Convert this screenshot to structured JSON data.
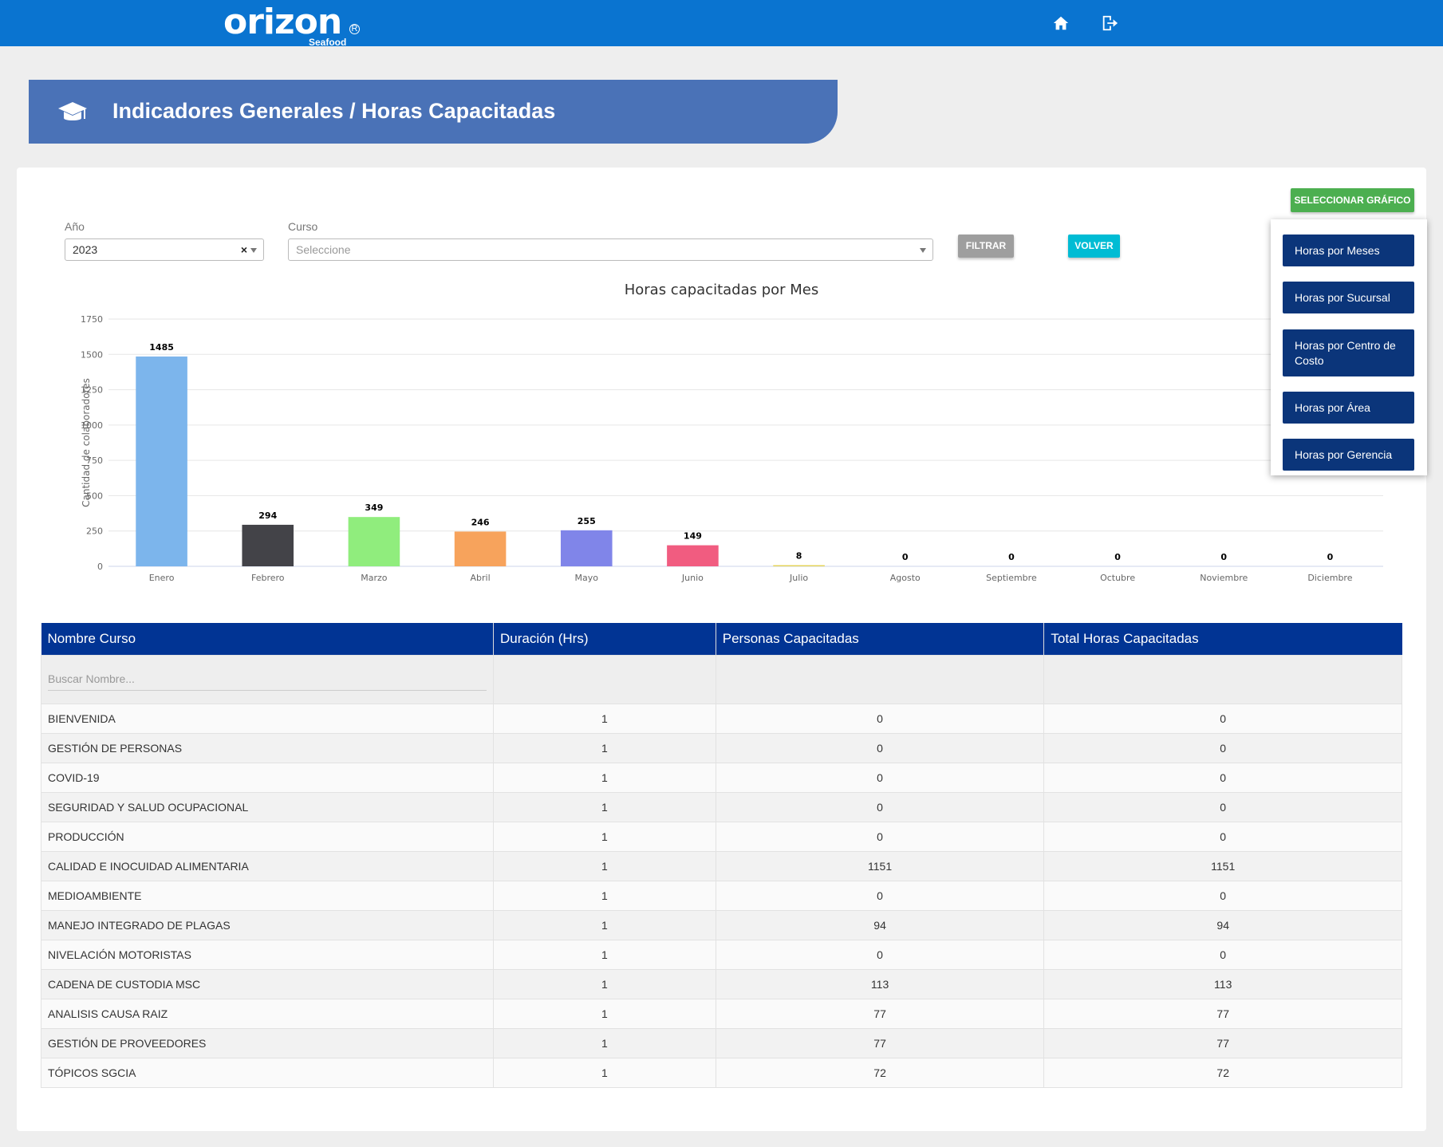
{
  "header": {
    "logo_text": "orizon",
    "logo_sub": "Seafood",
    "logo_reg": "R",
    "bg_color": "#0a74d0",
    "icons": [
      "home-icon",
      "logout-icon"
    ]
  },
  "banner": {
    "title": "Indicadores Generales / Horas Capacitadas",
    "icon": "graduation-cap-icon",
    "bg_color": "#4a72b7"
  },
  "filters": {
    "year_label": "Año",
    "year_value": "2023",
    "year_clear": "×",
    "course_label": "Curso",
    "course_placeholder": "Seleccione",
    "filter_button": "FILTRAR",
    "back_button": "VOLVER",
    "select_chart_button": "SELECCIONAR GRÁFICO"
  },
  "chart_menu": {
    "items": [
      "Horas por Meses",
      "Horas por Sucursal",
      "Horas por Centro de Costo",
      "Horas por Área",
      "Horas por Gerencia"
    ]
  },
  "chart_data": {
    "type": "bar",
    "title": "Horas capacitadas por Mes",
    "ylabel": "Cantidad de colaboradores",
    "xlabel": "",
    "ylim": [
      0,
      1750
    ],
    "yticks": [
      0,
      250,
      500,
      750,
      1000,
      1250,
      1500,
      1750
    ],
    "grid": true,
    "categories": [
      "Enero",
      "Febrero",
      "Marzo",
      "Abril",
      "Mayo",
      "Junio",
      "Julio",
      "Agosto",
      "Septiembre",
      "Octubre",
      "Noviembre",
      "Diciembre"
    ],
    "values": [
      1485,
      294,
      349,
      246,
      255,
      149,
      8,
      0,
      0,
      0,
      0,
      0
    ],
    "colors": [
      "#7cb5ec",
      "#434348",
      "#90ed7d",
      "#f7a35c",
      "#8085e9",
      "#f15c80",
      "#e4d354",
      "#2b908f",
      "#f45b5b",
      "#91e8e1",
      "#7cb5ec",
      "#434348"
    ]
  },
  "table": {
    "headers": [
      "Nombre Curso",
      "Duración (Hrs)",
      "Personas Capacitadas",
      "Total Horas Capacitadas"
    ],
    "search_placeholder": "Buscar Nombre...",
    "rows": [
      [
        "BIENVENIDA",
        "1",
        "0",
        "0"
      ],
      [
        "GESTIÓN DE PERSONAS",
        "1",
        "0",
        "0"
      ],
      [
        "COVID-19",
        "1",
        "0",
        "0"
      ],
      [
        "SEGURIDAD Y SALUD OCUPACIONAL",
        "1",
        "0",
        "0"
      ],
      [
        "PRODUCCIÓN",
        "1",
        "0",
        "0"
      ],
      [
        "CALIDAD E INOCUIDAD ALIMENTARIA",
        "1",
        "1151",
        "1151"
      ],
      [
        "MEDIOAMBIENTE",
        "1",
        "0",
        "0"
      ],
      [
        "MANEJO INTEGRADO DE PLAGAS",
        "1",
        "94",
        "94"
      ],
      [
        "NIVELACIÓN MOTORISTAS",
        "1",
        "0",
        "0"
      ],
      [
        "CADENA DE CUSTODIA MSC",
        "1",
        "113",
        "113"
      ],
      [
        "ANALISIS CAUSA RAIZ",
        "1",
        "77",
        "77"
      ],
      [
        "GESTIÓN DE PROVEEDORES",
        "1",
        "77",
        "77"
      ],
      [
        "TÓPICOS SGCIA",
        "1",
        "72",
        "72"
      ]
    ]
  }
}
